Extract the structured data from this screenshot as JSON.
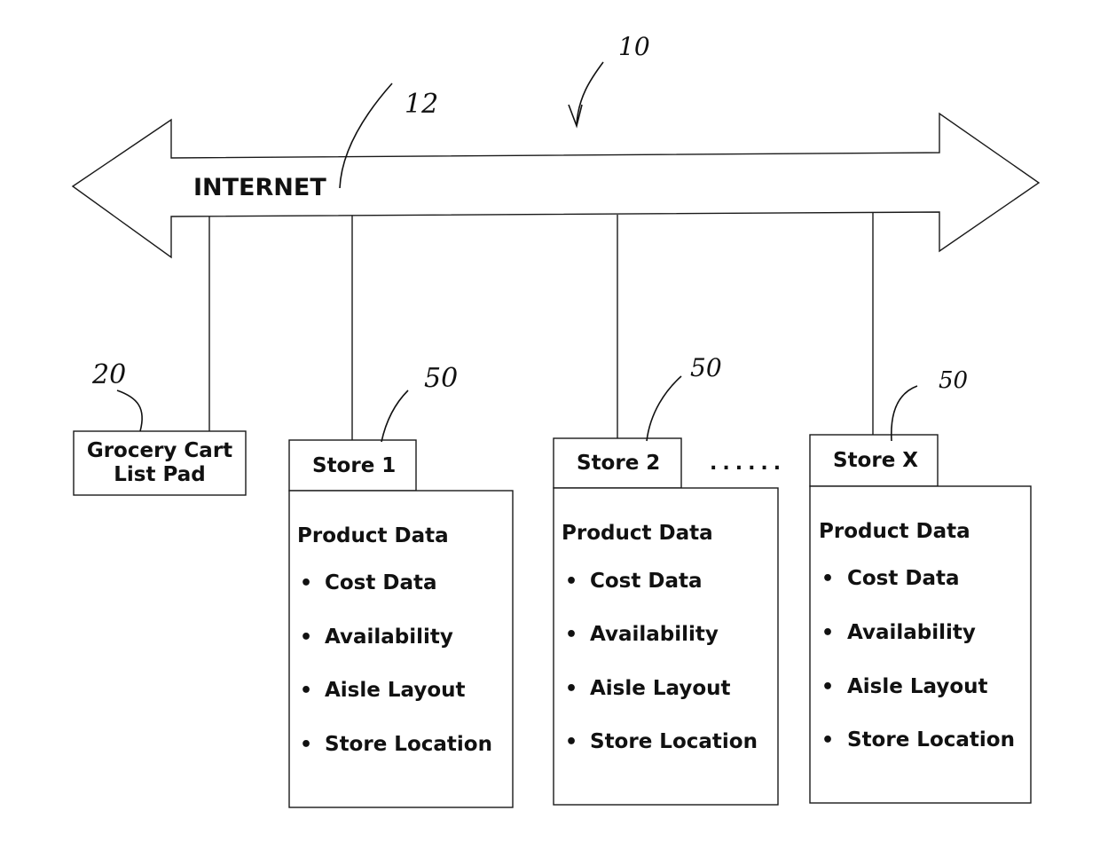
{
  "figure": {
    "reference_numeral": "10",
    "network": {
      "label": "INTERNET",
      "reference_numeral": "12"
    },
    "client_device": {
      "label_lines": [
        "Grocery Cart",
        "List Pad"
      ],
      "reference_numeral": "20"
    },
    "ellipsis": "......",
    "stores": [
      {
        "name": "Store 1",
        "reference_numeral": "50",
        "heading": "Product Data",
        "items": [
          "Cost Data",
          "Availability",
          "Aisle Layout",
          "Store Location"
        ]
      },
      {
        "name": "Store 2",
        "reference_numeral": "50",
        "heading": "Product Data",
        "items": [
          "Cost Data",
          "Availability",
          "Aisle Layout",
          "Store Location"
        ]
      },
      {
        "name": "Store X",
        "reference_numeral": "50",
        "heading": "Product Data",
        "items": [
          "Cost Data",
          "Availability",
          "Aisle Layout",
          "Store Location"
        ]
      }
    ],
    "bullet_glyph": "•"
  }
}
